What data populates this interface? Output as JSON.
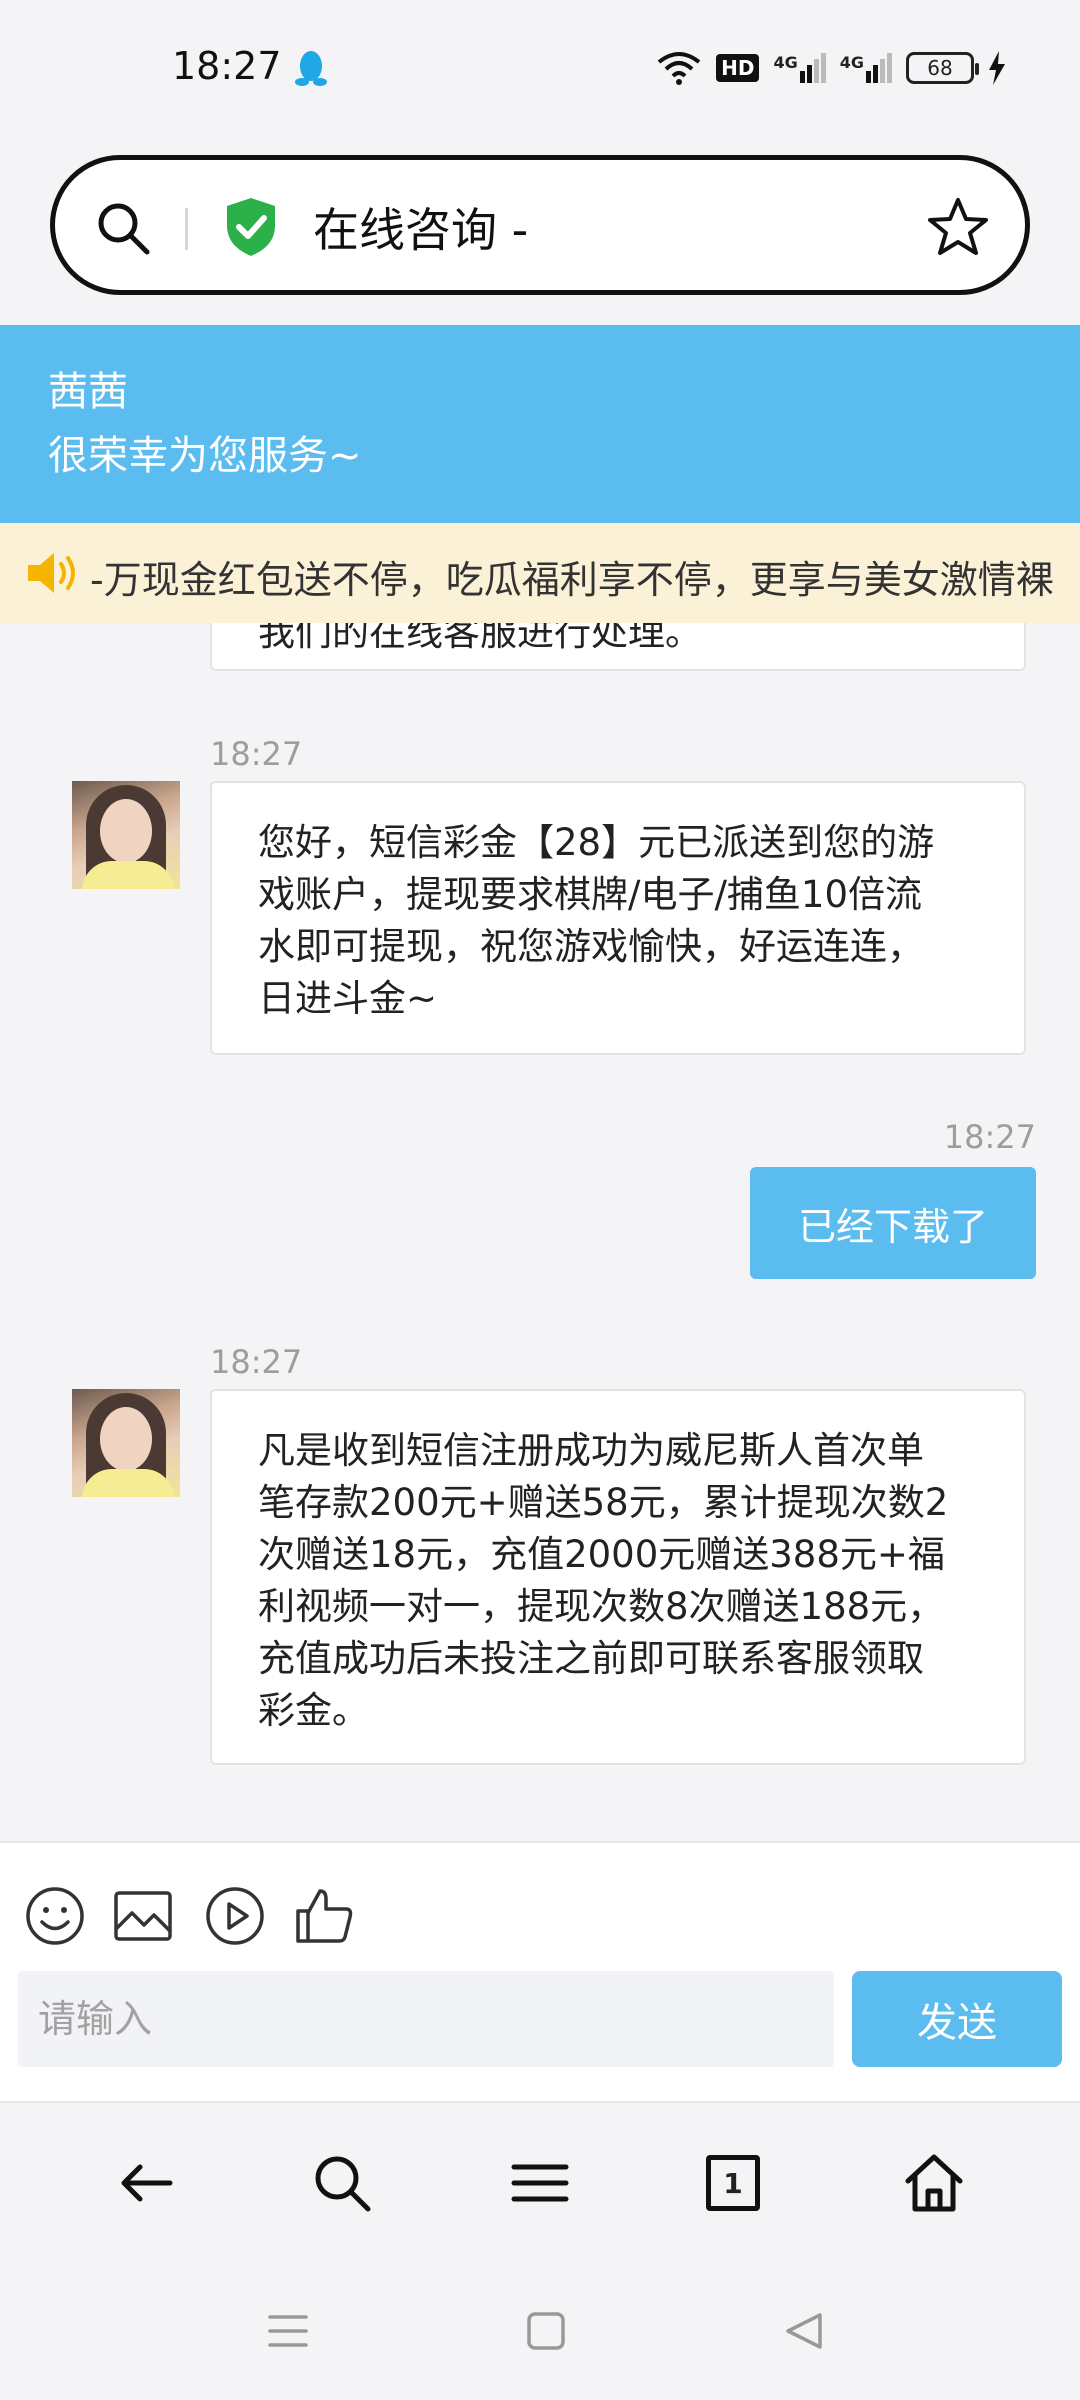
{
  "status_bar": {
    "time": "18:27",
    "qq_icon": "qq-penguin-icon",
    "hd_label": "HD",
    "network_1": "4G",
    "network_2": "4G",
    "battery": "68",
    "charging_icon": "charging-bolt-icon"
  },
  "address_bar": {
    "title": "在线咨询 -",
    "search_icon": "search-icon",
    "shield_icon": "shield-check-icon",
    "star_icon": "star-icon",
    "shield_color": "#2bb04a"
  },
  "chat_header": {
    "agent_name": "茜茜",
    "greeting": "很荣幸为您服务~",
    "color": "#5bbcef"
  },
  "marquee": {
    "icon": "speaker-icon",
    "text": "-万现金红包送不停，吃瓜福利享不停，更享与美女激情裸"
  },
  "messages": [
    {
      "from": "agent",
      "text": "我们的在线客服进行处理。"
    },
    {
      "from": "agent",
      "time": "18:27",
      "lines": [
        "您好，短信彩金【28】元已派送到您的游",
        "戏账户，提现要求棋牌/电子/捕鱼10倍流",
        "水即可提现，祝您游戏愉快，好运连连，",
        "日进斗金~"
      ]
    },
    {
      "from": "user",
      "time": "18:27",
      "text": "已经下载了"
    },
    {
      "from": "agent",
      "time": "18:27",
      "lines": [
        "凡是收到短信注册成功为威尼斯人首次单",
        "笔存款200元+赠送58元，累计提现次数2",
        "次赠送18元，充值2000元赠送388元+福",
        "利视频一对一，提现次数8次赠送188元，",
        "充值成功后未投注之前即可联系客服领取",
        "彩金。"
      ]
    }
  ],
  "toolbar": {
    "emoji_icon": "emoji-icon",
    "image_icon": "image-icon",
    "video_icon": "play-icon",
    "like_icon": "thumbs-up-icon"
  },
  "input": {
    "placeholder": "请输入",
    "value": ""
  },
  "send_label": "发送",
  "browser_nav": {
    "back": "back-arrow-icon",
    "search": "search-icon",
    "menu": "menu-icon",
    "tabs_count": "1",
    "home": "home-icon"
  }
}
